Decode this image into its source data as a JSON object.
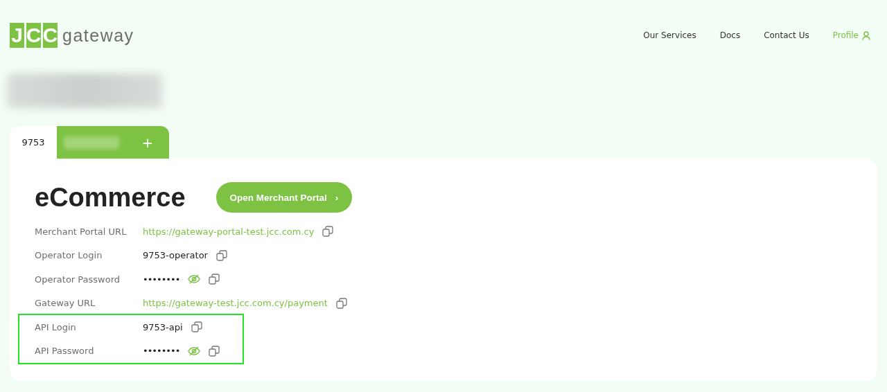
{
  "logo": {
    "letters": [
      "J",
      "C",
      "C"
    ],
    "word": "gateway"
  },
  "nav": [
    {
      "label": "Our Services",
      "selected": false
    },
    {
      "label": "Docs",
      "selected": false
    },
    {
      "label": "Contact Us",
      "selected": false
    },
    {
      "label": "Profile",
      "selected": true
    }
  ],
  "tabs": [
    {
      "kind": "text",
      "label": "9753",
      "selected": true
    },
    {
      "kind": "redacted",
      "selected": false
    }
  ],
  "add_tab": "+",
  "card": {
    "title": "eCommerce",
    "button": "Open Merchant Portal",
    "button_icon": "›",
    "rows": [
      {
        "label": "Merchant Portal URL",
        "kind": "link",
        "value": "https://gateway-portal-test.jcc.com.cy",
        "highlighted": false
      },
      {
        "label": "Operator Login",
        "kind": "text",
        "value": "9753-operator",
        "highlighted": false
      },
      {
        "label": "Operator Password",
        "kind": "secret",
        "value": "••••••••",
        "revealed": false,
        "highlighted": false
      },
      {
        "label": "Gateway URL",
        "kind": "link",
        "value": "https://gateway-test.jcc.com.cy/payment",
        "highlighted": false
      },
      {
        "label": "API Login",
        "kind": "text",
        "value": "9753-api",
        "highlighted": true
      },
      {
        "label": "API Password",
        "kind": "secret",
        "value": "••••••••",
        "revealed": false,
        "highlighted": true
      }
    ]
  }
}
